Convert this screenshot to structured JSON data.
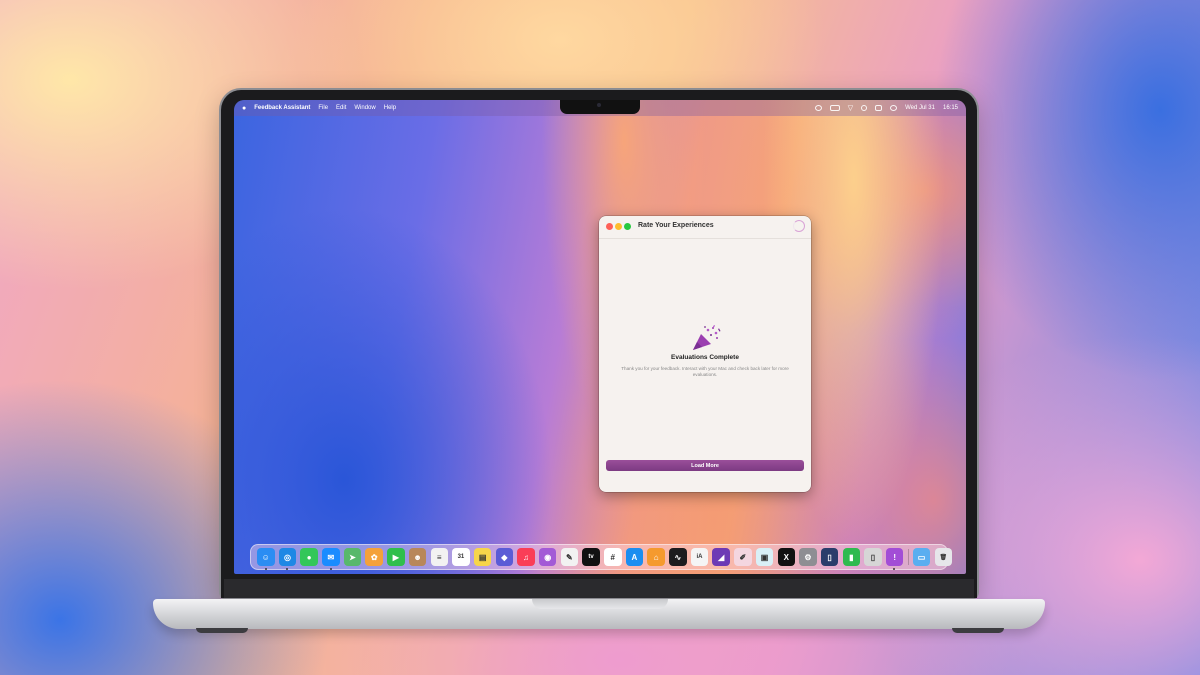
{
  "menubar": {
    "apple": "",
    "app_name": "Feedback Assistant",
    "menus": [
      "File",
      "Edit",
      "Window",
      "Help"
    ],
    "date": "Wed Jul 31",
    "time": "16:15",
    "status_icons": [
      "stage-manager-icon",
      "battery-icon",
      "wifi-icon",
      "search-icon",
      "control-center-icon",
      "siri-icon"
    ]
  },
  "window": {
    "title": "Rate Your Experiences",
    "heading": "Evaluations Complete",
    "message": "Thank you for your feedback. Interact with your Mac and check back later for more evaluations.",
    "button": "Load More",
    "icon": "party-popper-icon"
  },
  "dock": {
    "apps": [
      {
        "name": "finder",
        "glyph": "☺",
        "color": "#2b8df3",
        "running": true
      },
      {
        "name": "safari",
        "glyph": "◎",
        "color": "#1e88e5",
        "running": true
      },
      {
        "name": "messages",
        "glyph": "●",
        "color": "#33c759",
        "running": false
      },
      {
        "name": "mail",
        "glyph": "✉",
        "color": "#1a8cff",
        "running": true
      },
      {
        "name": "maps",
        "glyph": "➤",
        "color": "#58b86b",
        "running": false
      },
      {
        "name": "photos",
        "glyph": "✿",
        "color": "#f4a13a",
        "running": false
      },
      {
        "name": "facetime",
        "glyph": "▶",
        "color": "#2fbf4b",
        "running": false
      },
      {
        "name": "contacts",
        "glyph": "☻",
        "color": "#b8875a",
        "running": false
      },
      {
        "name": "reminders",
        "glyph": "≡",
        "color": "#f2f2f2",
        "running": false
      },
      {
        "name": "calendar",
        "glyph": "31",
        "color": "#ffffff",
        "running": false
      },
      {
        "name": "notes",
        "glyph": "▤",
        "color": "#f7d54a",
        "running": false
      },
      {
        "name": "shortcuts",
        "glyph": "◆",
        "color": "#5b5cd6",
        "running": false
      },
      {
        "name": "music",
        "glyph": "♫",
        "color": "#fa3e57",
        "running": false
      },
      {
        "name": "podcasts",
        "glyph": "◉",
        "color": "#a35ad6",
        "running": false
      },
      {
        "name": "freeform",
        "glyph": "✎",
        "color": "#f2f2f2",
        "running": false
      },
      {
        "name": "tv",
        "glyph": "tv",
        "color": "#111111",
        "running": false
      },
      {
        "name": "slack",
        "glyph": "#",
        "color": "#ffffff",
        "running": false
      },
      {
        "name": "app-store",
        "glyph": "A",
        "color": "#1c8ef0",
        "running": false
      },
      {
        "name": "home",
        "glyph": "⌂",
        "color": "#f59a2e",
        "running": false
      },
      {
        "name": "stocks",
        "glyph": "∿",
        "color": "#1c1c1e",
        "running": false
      },
      {
        "name": "ia-writer",
        "glyph": "iA",
        "color": "#f5f5f5",
        "running": false
      },
      {
        "name": "affinity",
        "glyph": "◢",
        "color": "#6d3ab5",
        "running": false
      },
      {
        "name": "pencil-app",
        "glyph": "✐",
        "color": "#f4d6e0",
        "running": false
      },
      {
        "name": "preview",
        "glyph": "▣",
        "color": "#d9f0f7",
        "running": false
      },
      {
        "name": "x",
        "glyph": "X",
        "color": "#111111",
        "running": false
      },
      {
        "name": "system-settings",
        "glyph": "⚙",
        "color": "#8e8e93",
        "running": false
      },
      {
        "name": "iphone-mirroring",
        "glyph": "▯",
        "color": "#2a3d6b",
        "running": false
      },
      {
        "name": "numbers",
        "glyph": "▮",
        "color": "#2fba4f",
        "running": false
      },
      {
        "name": "phone-mirror",
        "glyph": "▯",
        "color": "#d6d6d6",
        "running": false
      },
      {
        "name": "feedback-assistant",
        "glyph": "!",
        "color": "#a24dd6",
        "running": true
      }
    ],
    "extras": [
      {
        "name": "downloads",
        "glyph": "▭",
        "color": "#5aaef0"
      },
      {
        "name": "trash",
        "glyph": "🗑",
        "color": "#e6e6ea"
      }
    ]
  }
}
